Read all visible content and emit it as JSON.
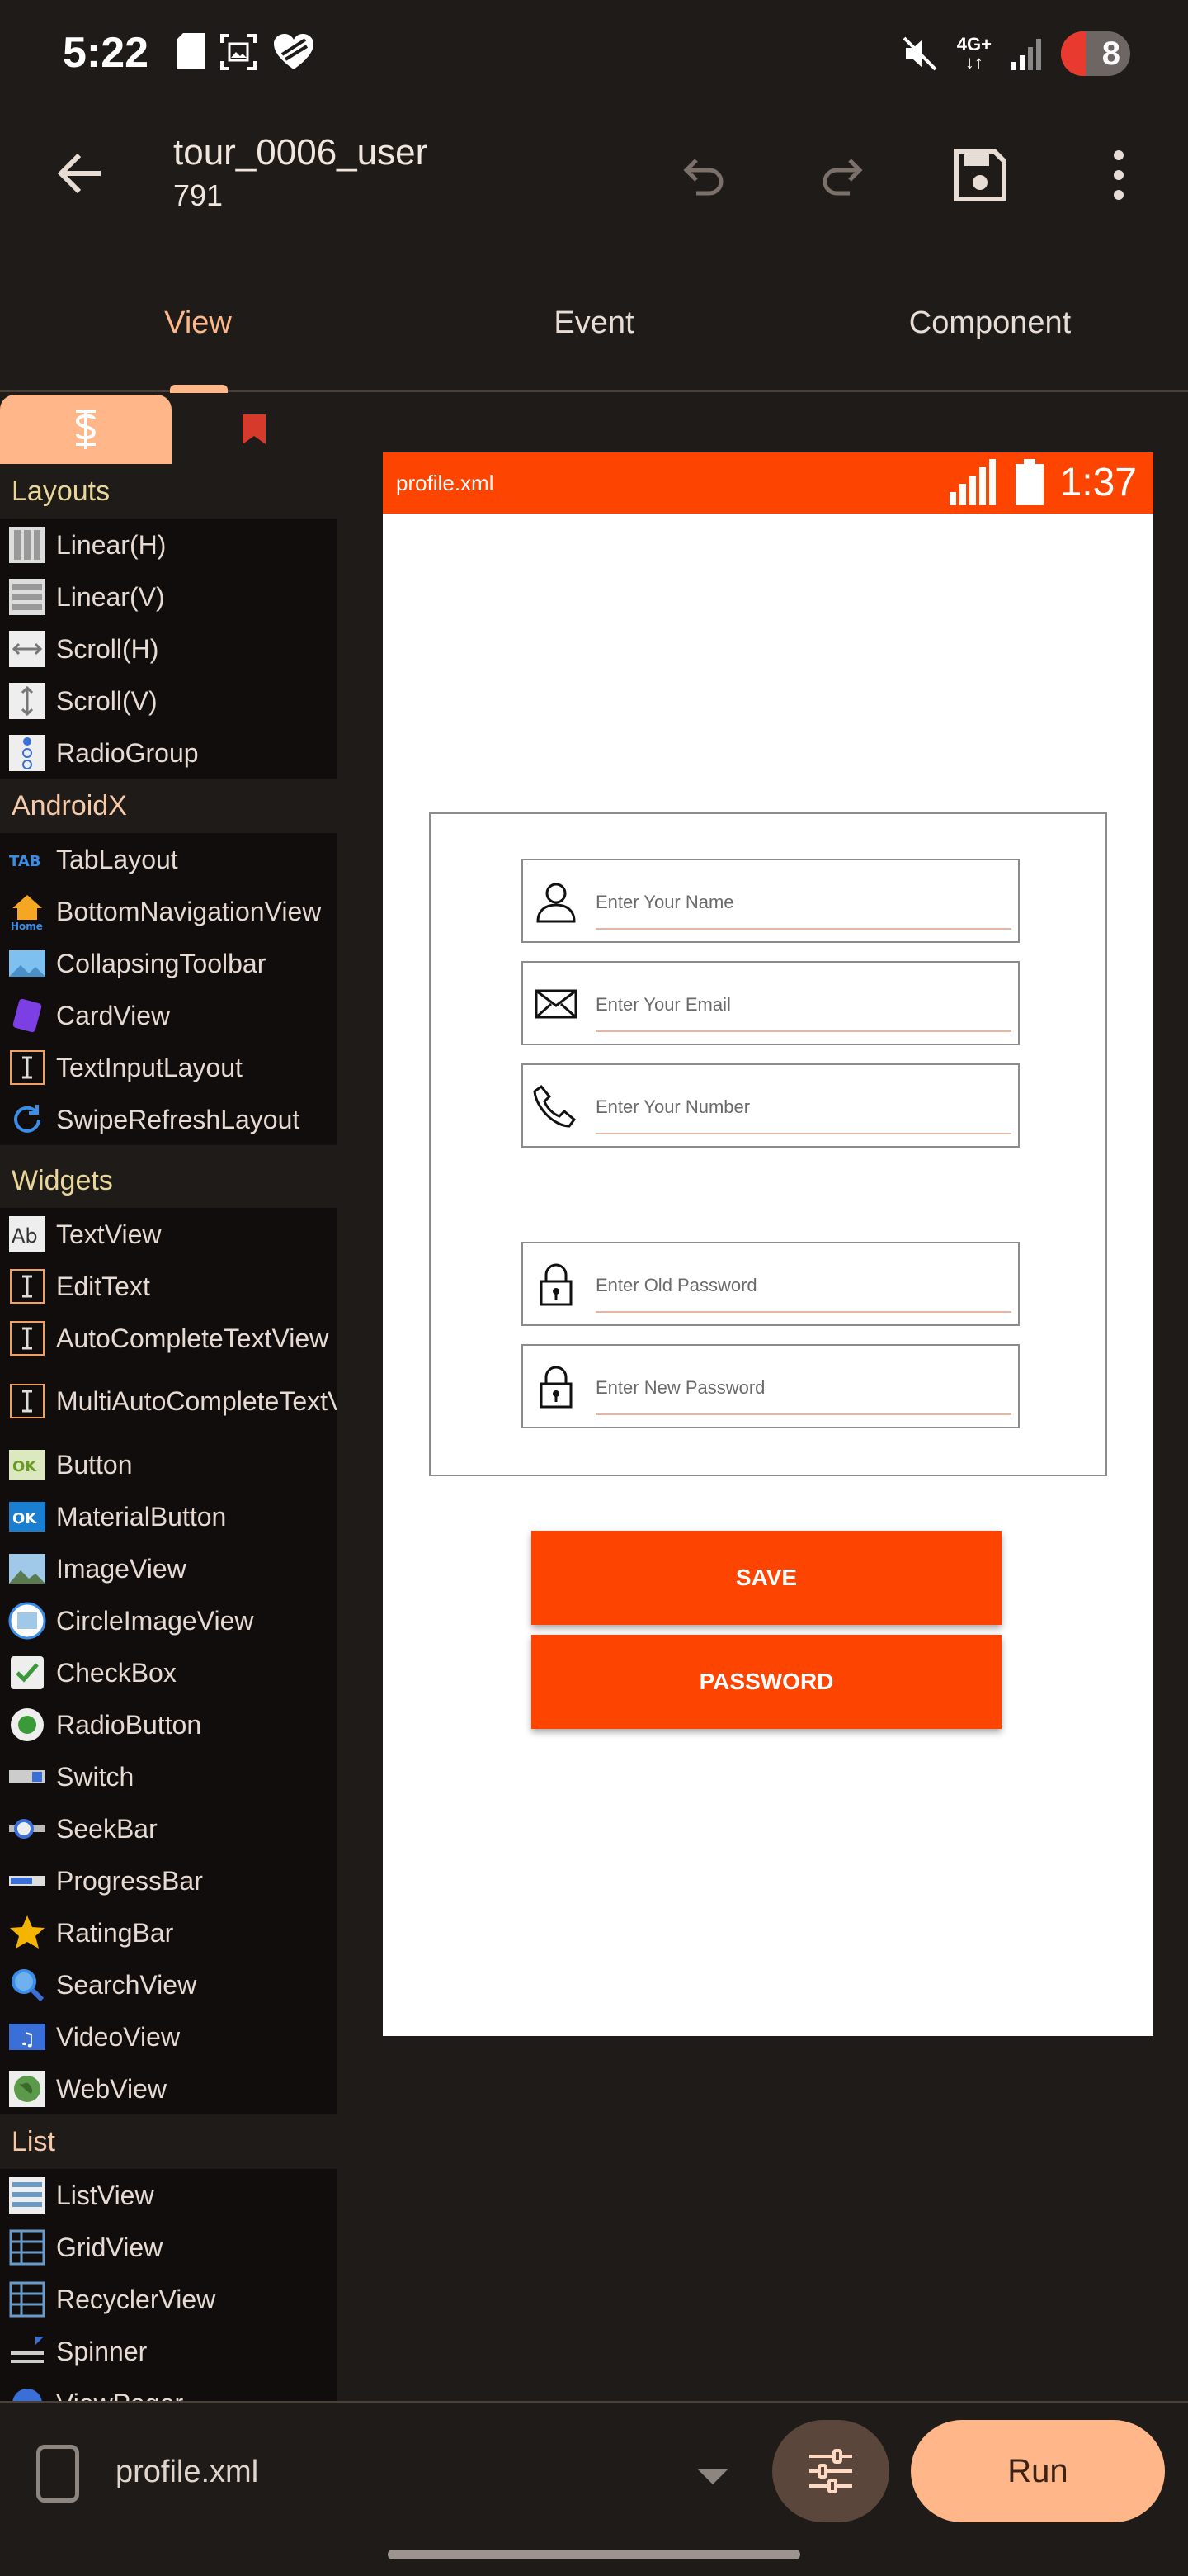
{
  "status_bar": {
    "time": "5:22",
    "network": "4G+",
    "battery": "8"
  },
  "app_bar": {
    "title_line1": "tour_0006_user",
    "title_line2": "791",
    "back_icon": "arrow-left-icon",
    "undo_icon": "undo-icon",
    "redo_icon": "redo-icon",
    "save_icon": "save-icon",
    "menu_icon": "more-vertical-icon"
  },
  "tabs": [
    {
      "label": "View",
      "active": true
    },
    {
      "label": "Event",
      "active": false
    },
    {
      "label": "Component",
      "active": false
    }
  ],
  "palette": {
    "sections": [
      {
        "title": "Layouts",
        "items": [
          "Linear(H)",
          "Linear(V)",
          "Scroll(H)",
          "Scroll(V)",
          "RadioGroup"
        ]
      },
      {
        "title": "AndroidX",
        "items": [
          "TabLayout",
          "BottomNavigationView",
          "CollapsingToolbar",
          "CardView",
          "TextInputLayout",
          "SwipeRefreshLayout"
        ]
      },
      {
        "title": "Widgets",
        "items": [
          "TextView",
          "EditText",
          "AutoCompleteTextView",
          "MultiAutoCompleteTextView",
          "Button",
          "MaterialButton",
          "ImageView",
          "CircleImageView",
          "CheckBox",
          "RadioButton",
          "Switch",
          "SeekBar",
          "ProgressBar",
          "RatingBar",
          "SearchView",
          "VideoView",
          "WebView"
        ]
      },
      {
        "title": "List",
        "items": [
          "ListView",
          "GridView",
          "RecyclerView",
          "Spinner",
          "ViewPager"
        ]
      }
    ]
  },
  "preview": {
    "file": "profile.xml",
    "time": "1:37",
    "accent": "#fd4401",
    "fields": [
      {
        "hint": "Enter Your Name",
        "icon": "person-icon"
      },
      {
        "hint": "Enter Your Email",
        "icon": "mail-icon"
      },
      {
        "hint": "Enter Your Number",
        "icon": "phone-icon"
      },
      {
        "hint": "Enter Old Password",
        "icon": "lock-icon"
      },
      {
        "hint": "Enter New Password",
        "icon": "lock-icon"
      }
    ],
    "buttons": [
      "SAVE",
      "PASSWORD"
    ]
  },
  "bottom_bar": {
    "file": "profile.xml",
    "run_label": "Run"
  }
}
